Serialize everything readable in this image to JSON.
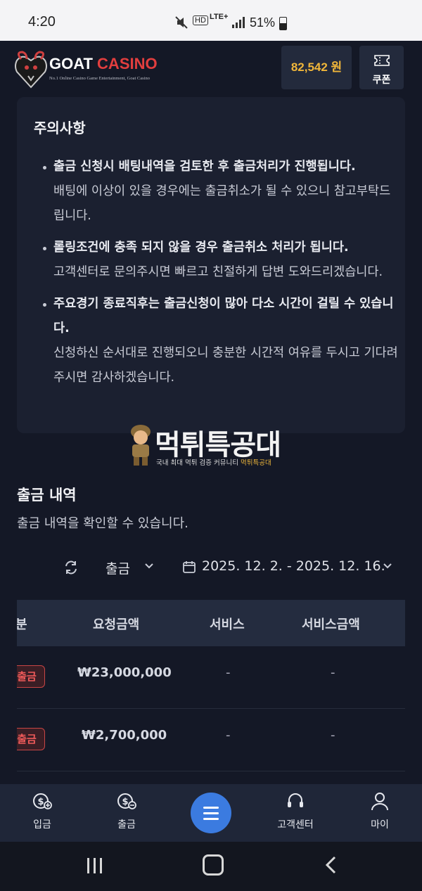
{
  "status_bar": {
    "time": "4:20",
    "hd": "HD",
    "lte": "LTE+",
    "battery": "51%"
  },
  "header": {
    "brand_left": "GOAT",
    "brand_right": "CASINO",
    "tagline": "No.1 Online Casino Game Entertainment, Goat Casino",
    "balance": "82,542 원",
    "coupon_label": "쿠폰"
  },
  "notice": {
    "title": "주의사항",
    "items": [
      {
        "bold": "출금 신청시 배팅내역을 검토한 후 출금처리가 진행됩니다.",
        "text": "배팅에 이상이 있을 경우에는 출금취소가 될 수 있으니 참고부탁드립니다."
      },
      {
        "bold": "롤링조건에 충족 되지 않을 경우 출금취소 처리가 됩니다.",
        "text": "고객센터로 문의주시면 빠르고 친절하게 답변 도와드리겠습니다."
      },
      {
        "bold": "주요경기 종료직후는 출금신청이 많아 다소 시간이 걸릴 수 있습니다.",
        "text": "신청하신 순서대로 진행되오니 충분한 시간적 여유를 두시고 기다려 주시면 감사하겠습니다."
      }
    ]
  },
  "watermark": {
    "title": "먹튀특공대",
    "subtitle_prefix": "국내 최대 먹튀 검증 커뮤니티 ",
    "subtitle_brand": "먹튀특공대"
  },
  "history": {
    "title": "출금 내역",
    "subtitle": "출금 내역을 확인할 수 있습니다.",
    "filter_type": "출금",
    "date_range": "2025. 12. 2. - 2025. 12. 16.",
    "columns": [
      "분",
      "요청금액",
      "서비스",
      "서비스금액"
    ],
    "rows": [
      {
        "type": "출금",
        "amount": "₩23,000,000",
        "service": "-",
        "service_amount": "-"
      },
      {
        "type": "출금",
        "amount": "₩2,700,000",
        "service": "-",
        "service_amount": "-"
      }
    ]
  },
  "bottom_nav": {
    "deposit": "입금",
    "withdraw": "출금",
    "support": "고객센터",
    "my": "마이"
  },
  "colors": {
    "accent": "#3b7be0",
    "balance": "#f0b63a",
    "brand_red": "#e23e3e",
    "badge_red": "#ef5a5a"
  }
}
